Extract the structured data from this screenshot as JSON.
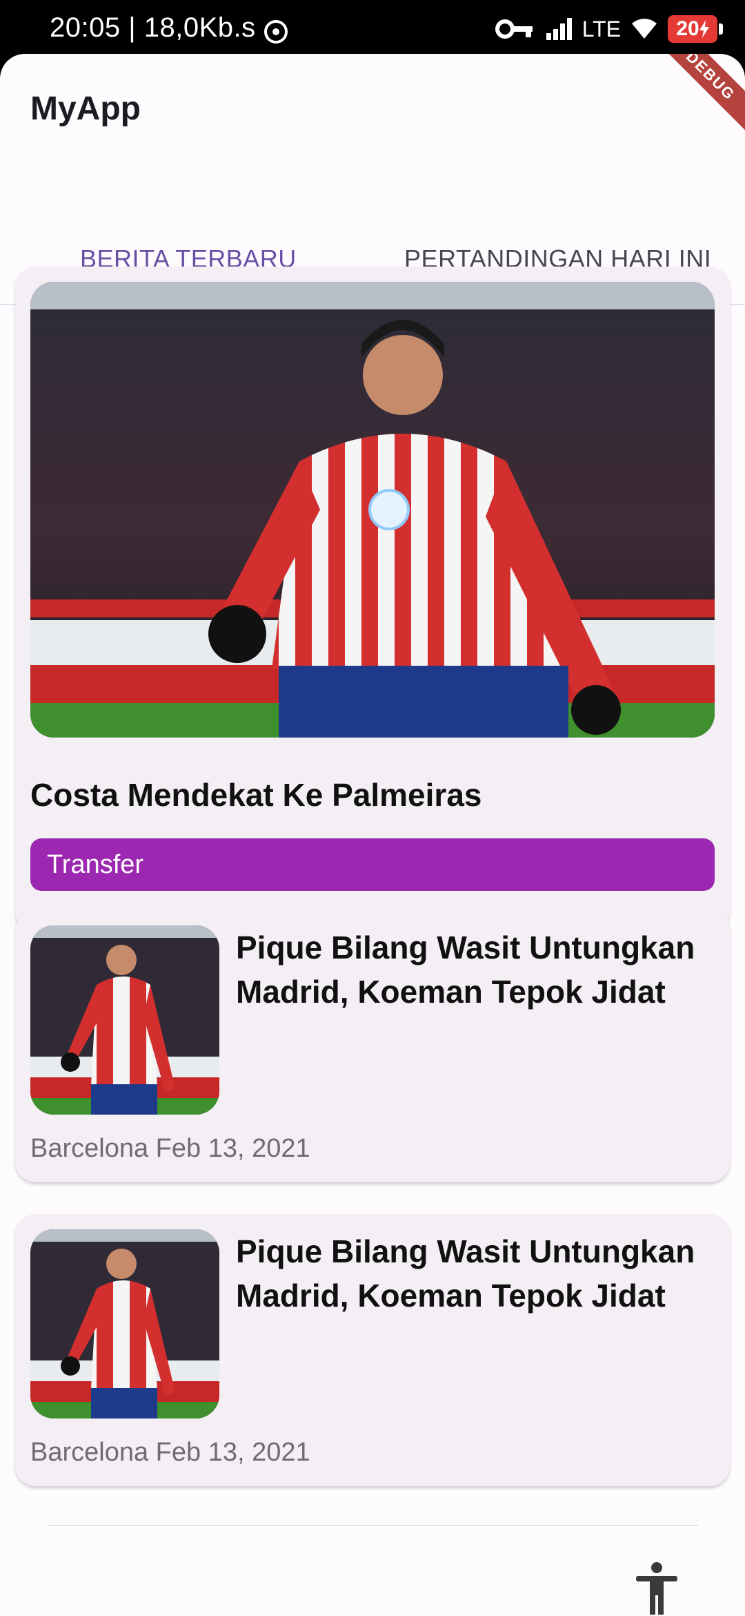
{
  "status_bar": {
    "time_speed": "20:05 | 18,0Kb.s",
    "network": "LTE",
    "battery": "20"
  },
  "app": {
    "title": "MyApp",
    "debug_banner": "DEBUG"
  },
  "tabs": [
    {
      "label": "BERITA TERBARU",
      "active": true
    },
    {
      "label": "PERTANDINGAN HARI INI",
      "active": false
    }
  ],
  "featured": {
    "title": "Costa Mendekat Ke Palmeiras",
    "category": "Transfer"
  },
  "news": [
    {
      "title": "Pique Bilang Wasit Untungkan Madrid, Koeman Tepok Jidat",
      "meta": "Barcelona Feb 13, 2021"
    },
    {
      "title": "Pique Bilang Wasit Untungkan Madrid, Koeman Tepok Jidat",
      "meta": "Barcelona Feb 13, 2021"
    }
  ],
  "colors": {
    "accent": "#6750a4",
    "chip": "#9c27b0",
    "card": "#f4eff4",
    "battery": "#e53935"
  },
  "icons": {
    "sync": "sync-icon",
    "vpn_key": "key-icon",
    "signal": "signal-icon",
    "wifi": "wifi-icon",
    "battery": "battery-charging-icon",
    "accessibility": "accessibility-icon"
  }
}
